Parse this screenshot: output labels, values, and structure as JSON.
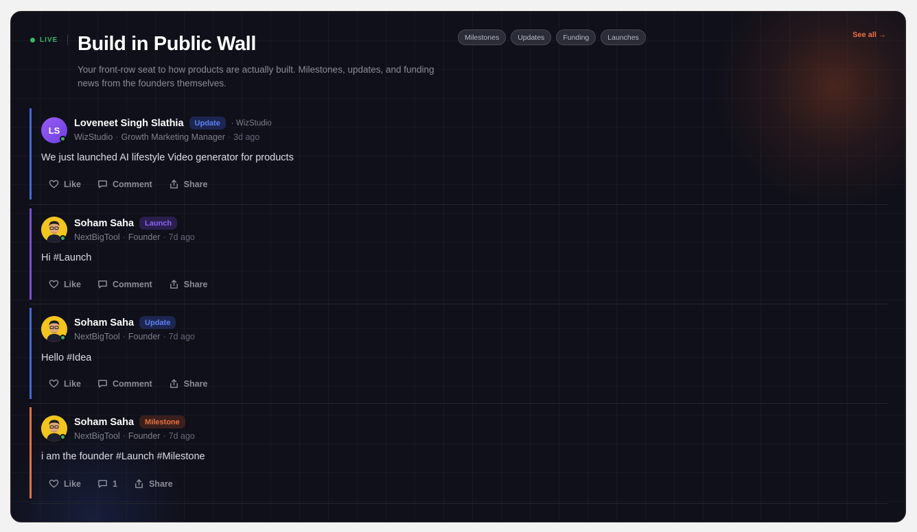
{
  "header": {
    "live_label": "LIVE",
    "title": "Build in Public Wall",
    "subtitle": "Your front-row seat to how products are actually built. Milestones, updates, and funding news from the founders themselves.",
    "filters": [
      "Milestones",
      "Updates",
      "Funding",
      "Launches"
    ],
    "see_all": "See all →"
  },
  "colors": {
    "update": "#4169e1",
    "launch": "#7c4ddf",
    "milestone": "#e8713f",
    "live": "#3fb46b"
  },
  "posts": [
    {
      "avatar_initials": "LS",
      "avatar_type": "initials",
      "name": "Loveneet Singh Slathia",
      "badge": "Update",
      "org_extra": "· WizStudio",
      "company": "WizStudio",
      "role": "Growth Marketing Manager",
      "time": "3d ago",
      "body": "We just launched AI lifestyle Video generator for products",
      "actions": {
        "like": "Like",
        "comment": "Comment",
        "share": "Share"
      }
    },
    {
      "avatar_type": "photo",
      "avatar_icon": "founder-avatar-photo",
      "name": "Soham Saha",
      "badge": "Launch",
      "company": "NextBigTool",
      "role": "Founder",
      "time": "7d ago",
      "body": "Hi #Launch",
      "actions": {
        "like": "Like",
        "comment": "Comment",
        "share": "Share"
      }
    },
    {
      "avatar_type": "photo",
      "avatar_icon": "founder-avatar-photo",
      "name": "Soham Saha",
      "badge": "Update",
      "company": "NextBigTool",
      "role": "Founder",
      "time": "7d ago",
      "body": "Hello #Idea",
      "actions": {
        "like": "Like",
        "comment": "Comment",
        "share": "Share"
      }
    },
    {
      "avatar_type": "photo",
      "avatar_icon": "founder-avatar-photo",
      "name": "Soham Saha",
      "badge": "Milestone",
      "company": "NextBigTool",
      "role": "Founder",
      "time": "7d ago",
      "body": "i am the founder #Launch #Milestone",
      "actions": {
        "like": "Like",
        "comment": "1",
        "share": "Share"
      }
    }
  ]
}
